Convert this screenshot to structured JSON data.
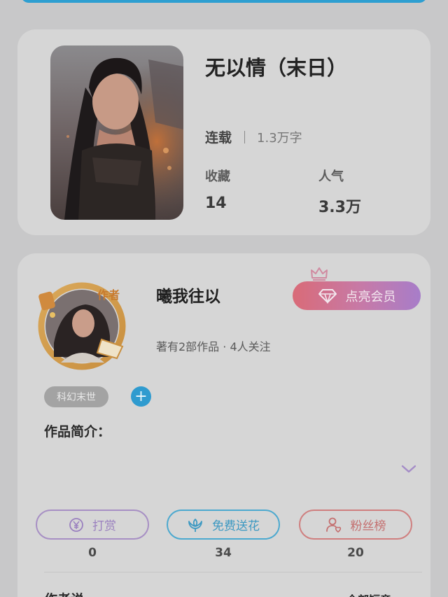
{
  "book": {
    "title": "无以情（末日）",
    "status": "连载",
    "word_count": "1.3万字",
    "stats": [
      {
        "label": "收藏",
        "value": "14"
      },
      {
        "label": "人气",
        "value": "3.3万"
      }
    ]
  },
  "author": {
    "name": "曦我往以",
    "badge_text": "作者",
    "description": "著有2部作品 · 4人关注",
    "vip_label": "点亮会员",
    "tag": "科幻末世",
    "intro_label": "作品简介："
  },
  "actions": [
    {
      "label": "打赏",
      "count": "0",
      "icon": "yen-icon"
    },
    {
      "label": "免费送花",
      "count": "34",
      "icon": "flower-icon"
    },
    {
      "label": "粉丝榜",
      "count": "20",
      "icon": "fans-icon"
    }
  ],
  "footer": {
    "author_says": "作者说",
    "all_chapters": "全部短章"
  },
  "colors": {
    "background": "#c8c8c9",
    "card": "#d6d6d6",
    "accent_blue": "#2f9bcf",
    "vip_gradient_start": "#d96b78",
    "vip_gradient_end": "#a77dc9"
  }
}
